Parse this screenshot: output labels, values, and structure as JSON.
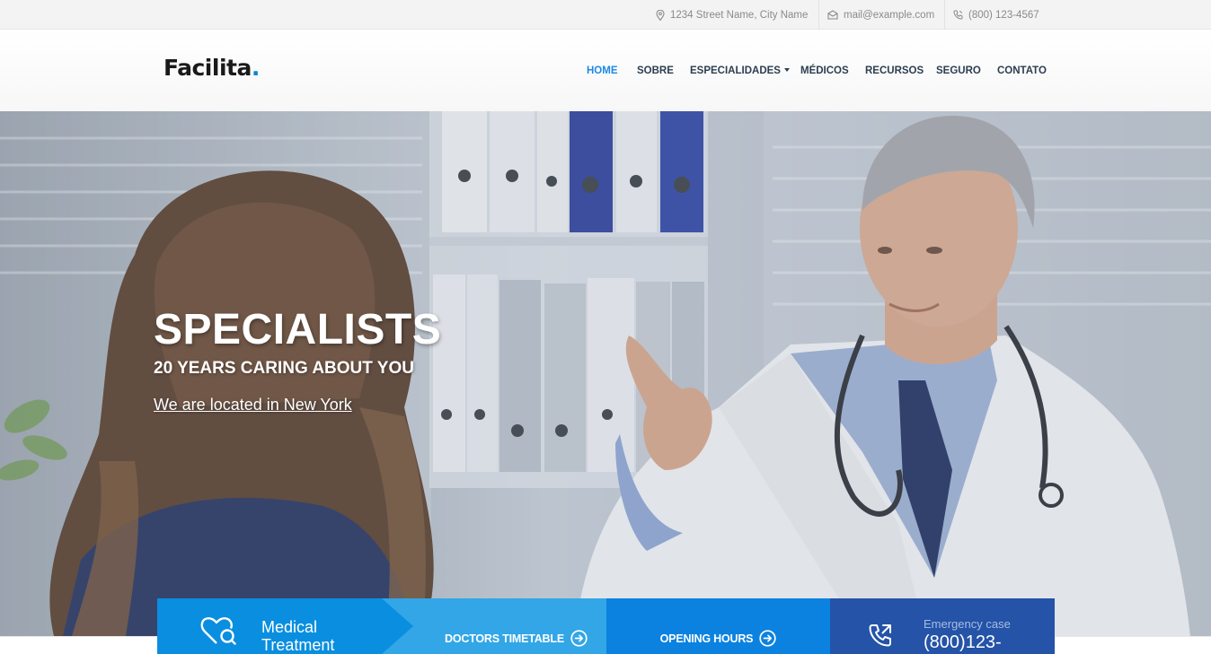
{
  "topbar": {
    "address": "1234 Street Name, City Name",
    "email": "mail@example.com",
    "phone": "(800) 123-4567"
  },
  "header": {
    "logo_text": "Facilita",
    "logo_dot": ".",
    "nav": {
      "home": "HOME",
      "sobre": "SOBRE",
      "especialidades": "ESPECIALIDADES",
      "medicos": "MÉDICOS",
      "recursos": "RECURSOS",
      "seguro": "SEGURO",
      "contato": "CONTATO"
    },
    "active_item": "home"
  },
  "hero": {
    "title": "SPECIALISTS",
    "subtitle": "20 YEARS CARING ABOUT YOU",
    "link": "We are located in New York"
  },
  "features": {
    "medical_line1": "Medical",
    "medical_line2": "Treatment",
    "timetable": "DOCTORS TIMETABLE",
    "hours": "OPENING HOURS",
    "emergency_label": "Emergency case",
    "emergency_phone": "(800)123-"
  },
  "icons": {
    "address": "map-pin-icon",
    "email": "envelope-icon",
    "phone": "phone-icon",
    "medical": "heart-search-icon",
    "arrow": "arrow-circle-right-icon",
    "emergency": "phone-call-icon"
  },
  "colors": {
    "accent": "#1e88e5",
    "feature_1": "#0a8ee0",
    "feature_2": "#32a6e6",
    "feature_3": "#0b82e0",
    "feature_4": "#2453a8"
  }
}
